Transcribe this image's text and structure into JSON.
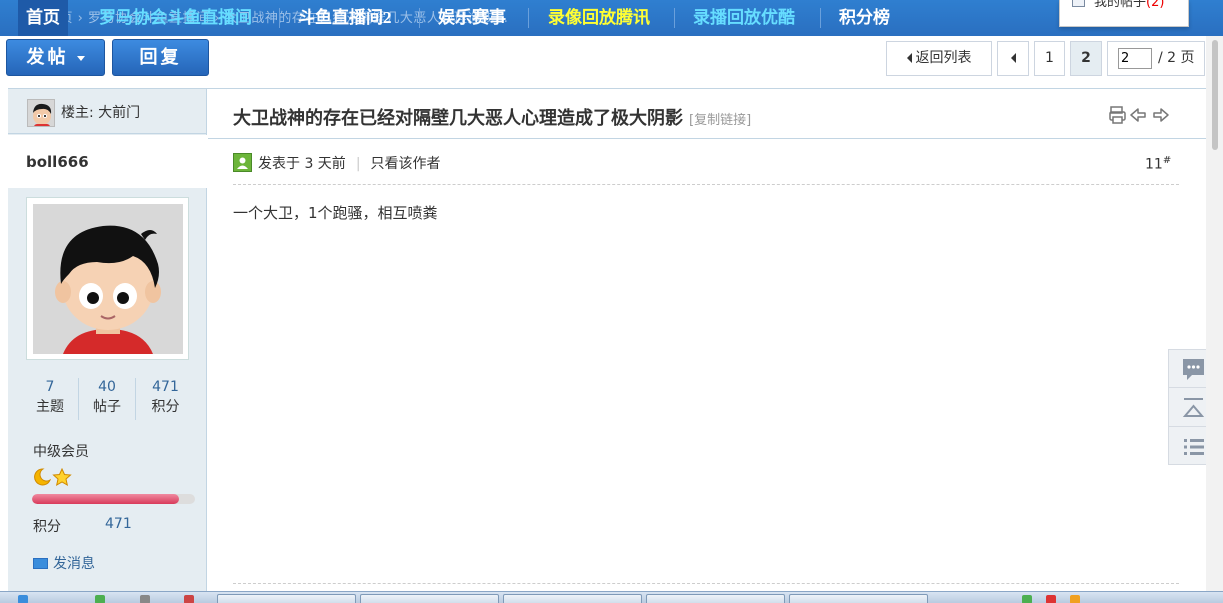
{
  "nav": {
    "breadcrumb": "首页  ›  罗马协会斗鱼直播间  ›  大卫战神的存在已经对隔壁几大恶人心理造成...",
    "items": [
      {
        "label": "首页"
      },
      {
        "label": "罗马协会斗鱼直播间"
      },
      {
        "label": "斗鱼直播间2"
      },
      {
        "label": "娱乐赛事"
      },
      {
        "label": "录像回放腾讯"
      },
      {
        "label": "录播回放优酷"
      },
      {
        "label": "积分榜"
      }
    ],
    "colors": {
      "home_bg": "#1e5aa8",
      "highlight_yellow": "#ffff33",
      "highlight_cyan": "#66ddff"
    }
  },
  "my_posts_popup": {
    "label": "我的帖子",
    "count": "(2)"
  },
  "actions": {
    "post_label": "发帖",
    "reply_label": "回复"
  },
  "pagination": {
    "back_label": "返回列表",
    "pages": [
      "1",
      "2"
    ],
    "current_page": "2",
    "total": "/ 2 页"
  },
  "author": {
    "owner_label": "楼主: 大前门",
    "username": "boll666",
    "stats": [
      {
        "value": "7",
        "label": "主题"
      },
      {
        "value": "40",
        "label": "帖子"
      },
      {
        "value": "471",
        "label": "积分"
      }
    ],
    "rank": "中级会员",
    "rank_icons": "🌙⭐",
    "rank_progress": 0.9,
    "score_label": "积分",
    "score_value": "471",
    "send_msg": "发消息"
  },
  "thread": {
    "title": "大卫战神的存在已经对隔壁几大恶人心理造成了极大阴影",
    "copy_link": "[复制链接]"
  },
  "post": {
    "posted": "发表于 3 天前",
    "only_author": "只看该作者",
    "floor": "11",
    "floor_sup": "#",
    "content": "一个大卫，1个跑骚，相互喷粪"
  },
  "icons": [
    "print-icon",
    "prev-thread-icon",
    "next-thread-icon",
    "comment-icon",
    "back-to-top-icon",
    "list-icon"
  ]
}
